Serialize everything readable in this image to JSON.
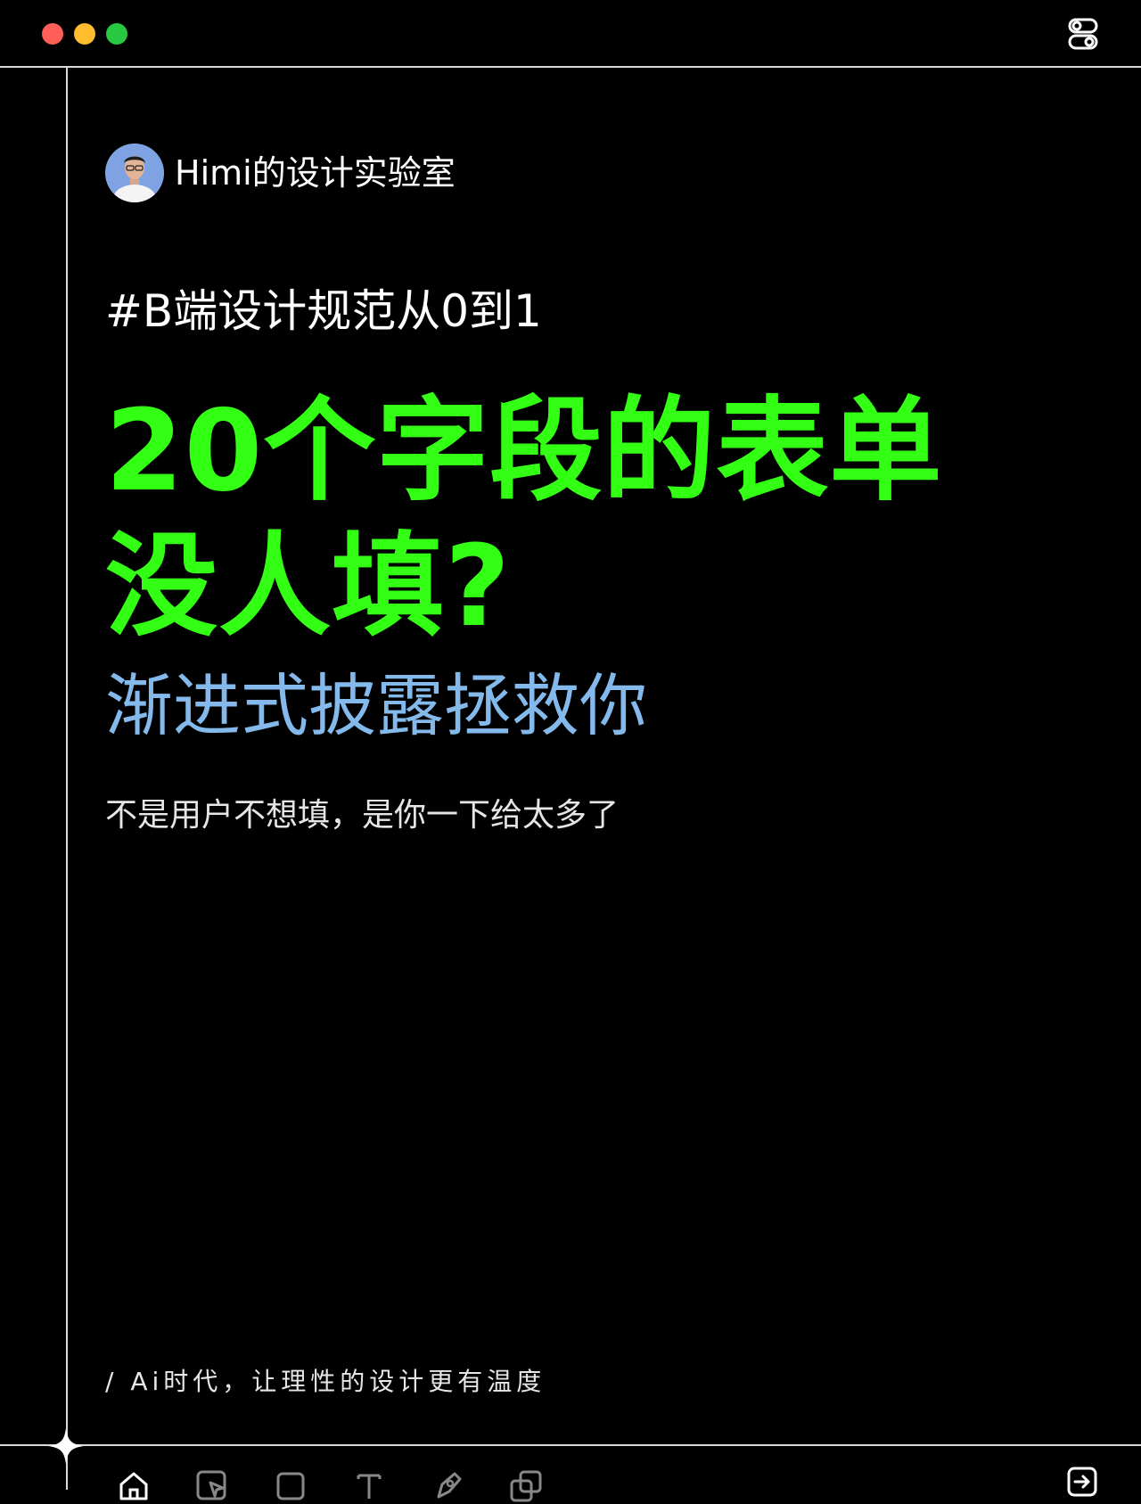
{
  "window": {
    "controls": [
      "close",
      "minimize",
      "maximize"
    ],
    "colors": {
      "close": "#ff5f57",
      "minimize": "#febc2e",
      "maximize": "#28c840"
    }
  },
  "author": {
    "name": "Himi的设计实验室",
    "avatar_icon": "avatar"
  },
  "content": {
    "hashtag": "#B端设计规范从0到1",
    "headline_line1": "20个字段的表单",
    "headline_line2": "没人填?",
    "subheadline": "渐进式披露拯救你",
    "tagline": "不是用户不想填，是你一下给太多了",
    "footer_slogan": "/ Ai时代，让理性的设计更有温度"
  },
  "colors": {
    "background": "#000000",
    "headline": "#33ff14",
    "subheadline": "#84b9eb",
    "text": "#ffffff",
    "lines": "#d9d9d9"
  },
  "toolbar": {
    "icons": [
      "home-icon",
      "cursor-icon",
      "rectangle-icon",
      "text-icon",
      "pen-icon",
      "copy-icon"
    ]
  },
  "top_right_icon": "toggle-icon",
  "bottom_right_icon": "exit-icon"
}
